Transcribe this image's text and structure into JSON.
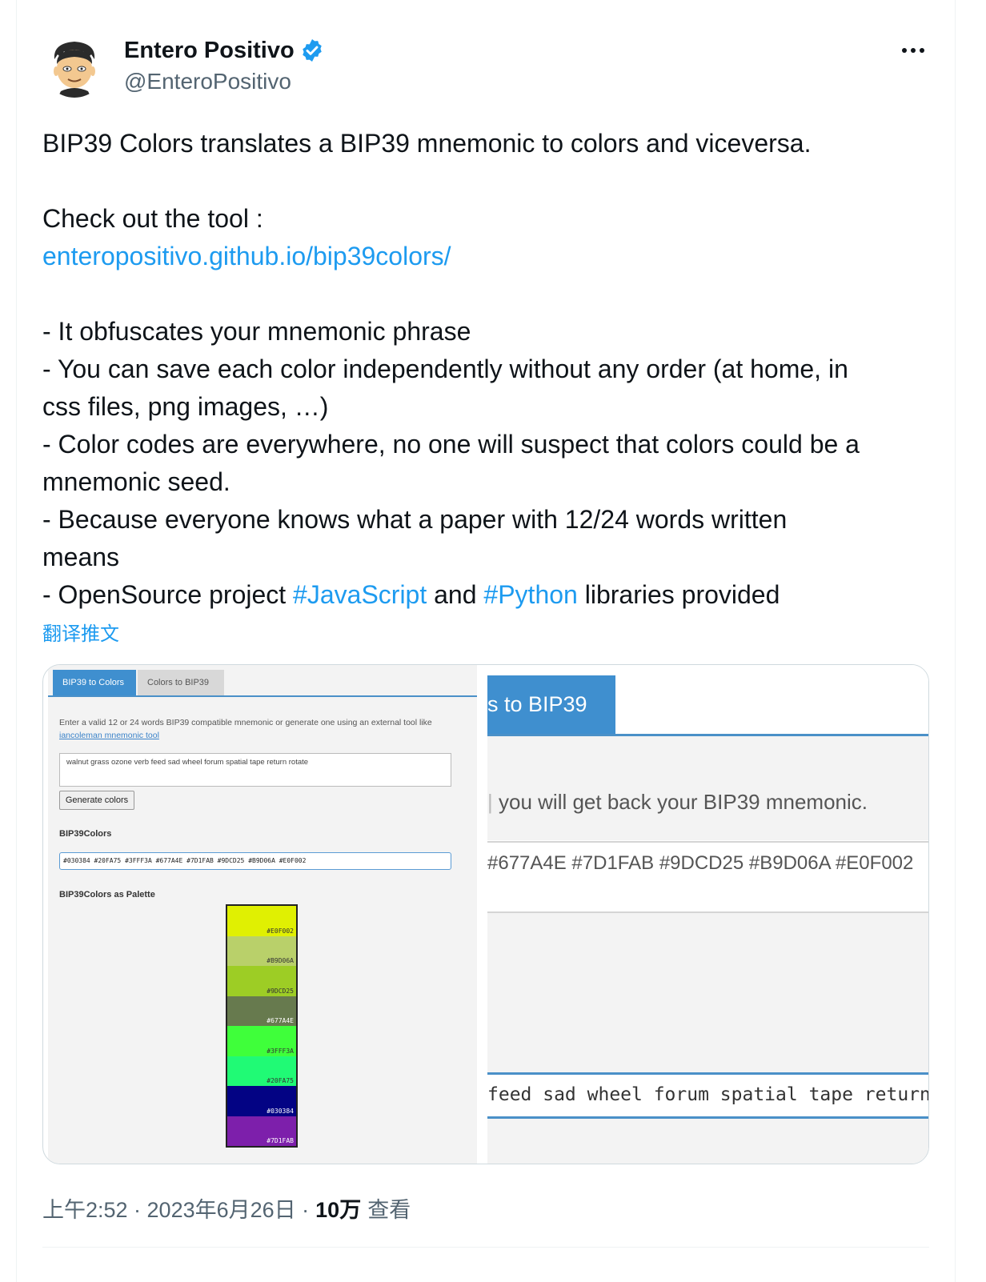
{
  "author": {
    "name": "Entero Positivo",
    "handle": "@EnteroPositivo",
    "verified": true
  },
  "tweet": {
    "line1": "BIP39 Colors translates a BIP39 mnemonic to colors and viceversa.",
    "line2": "Check out the tool :",
    "link": "enteropositivo.github.io/bip39colors/",
    "bullet1": "- It obfuscates your mnemonic phrase",
    "bullet2a": "- You can save each color independently without any order (at home, in",
    "bullet2b": "css files, png images, …)",
    "bullet3a": "- Color codes are everywhere, no one will suspect that colors could be a",
    "bullet3b": "mnemonic seed.",
    "bullet4a": "- Because everyone knows what a paper with 12/24 words written",
    "bullet4b": "means",
    "bullet5_pre": "- OpenSource project ",
    "hashtag1": "#JavaScript",
    "bullet5_mid": " and ",
    "hashtag2": "#Python",
    "bullet5_post": " libraries provided",
    "translate": "翻译推文"
  },
  "media_left": {
    "tab_active": "BIP39 to Colors",
    "tab_inactive": "Colors to BIP39",
    "desc": "Enter a valid 12 or 24 words BIP39 compatible mnemonic or generate one using an external tool like",
    "desc_link": "iancoleman mnemonic tool",
    "mnemonic": "walnut grass ozone verb feed sad wheel forum spatial tape return rotate",
    "generate_button": "Generate colors",
    "colors_label": "BIP39Colors",
    "codes": "#030384 #20FA75 #3FFF3A #677A4E #7D1FAB #9DCD25 #B9D06A #E0F002",
    "palette_label": "BIP39Colors as Palette",
    "palette": [
      {
        "code": "#E0F002",
        "color": "#E0F002",
        "text": "#333333"
      },
      {
        "code": "#B9D06A",
        "color": "#B9D06A",
        "text": "#333333"
      },
      {
        "code": "#9DCD25",
        "color": "#9DCD25",
        "text": "#333333"
      },
      {
        "code": "#677A4E",
        "color": "#677A4E",
        "text": "#ffffff"
      },
      {
        "code": "#3FFF3A",
        "color": "#3FFF3A",
        "text": "#333333"
      },
      {
        "code": "#20FA75",
        "color": "#20FA75",
        "text": "#333333"
      },
      {
        "code": "#030384",
        "color": "#030384",
        "text": "#ffffff"
      },
      {
        "code": "#7D1FAB",
        "color": "#7D1FAB",
        "text": "#ffffff"
      }
    ]
  },
  "media_right": {
    "tab": "s to BIP39",
    "desc": "you will get back your BIP39 mnemonic.",
    "codes": "#677A4E #7D1FAB #9DCD25 #B9D06A #E0F002",
    "words": "feed sad wheel forum spatial tape return ro"
  },
  "meta": {
    "time": "上午2:52 · 2023年6月26日 · ",
    "views": "10万",
    "views_label": "查看"
  },
  "colors": {
    "link": "#1d9bf0",
    "verified": "#1d9bf0",
    "tool_accent": "#3f8fcf"
  }
}
